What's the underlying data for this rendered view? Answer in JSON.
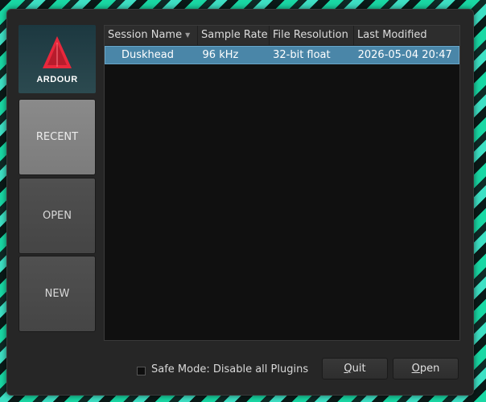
{
  "logo": {
    "text": "ARDOUR"
  },
  "sidebar": {
    "items": [
      {
        "label": "RECENT",
        "active": true
      },
      {
        "label": "OPEN",
        "active": false
      },
      {
        "label": "NEW",
        "active": false
      }
    ]
  },
  "sessions": {
    "columns": [
      "Session Name",
      "Sample Rate",
      "File Resolution",
      "Last Modified"
    ],
    "rows": [
      {
        "name": "Duskhead",
        "rate": "96 kHz",
        "resolution": "32-bit float",
        "modified": "2026-05-04 20:47"
      }
    ]
  },
  "footer": {
    "safe_mode_label": "Safe Mode: Disable all Plugins",
    "safe_mode_checked": false,
    "quit_mnemonic": "Q",
    "quit_rest": "uit",
    "open_mnemonic": "O",
    "open_rest": "pen"
  },
  "colors": {
    "selection": "#4a86a8",
    "dialog_bg": "#262626",
    "list_bg": "#101010",
    "logo_red": "#e8283c"
  }
}
